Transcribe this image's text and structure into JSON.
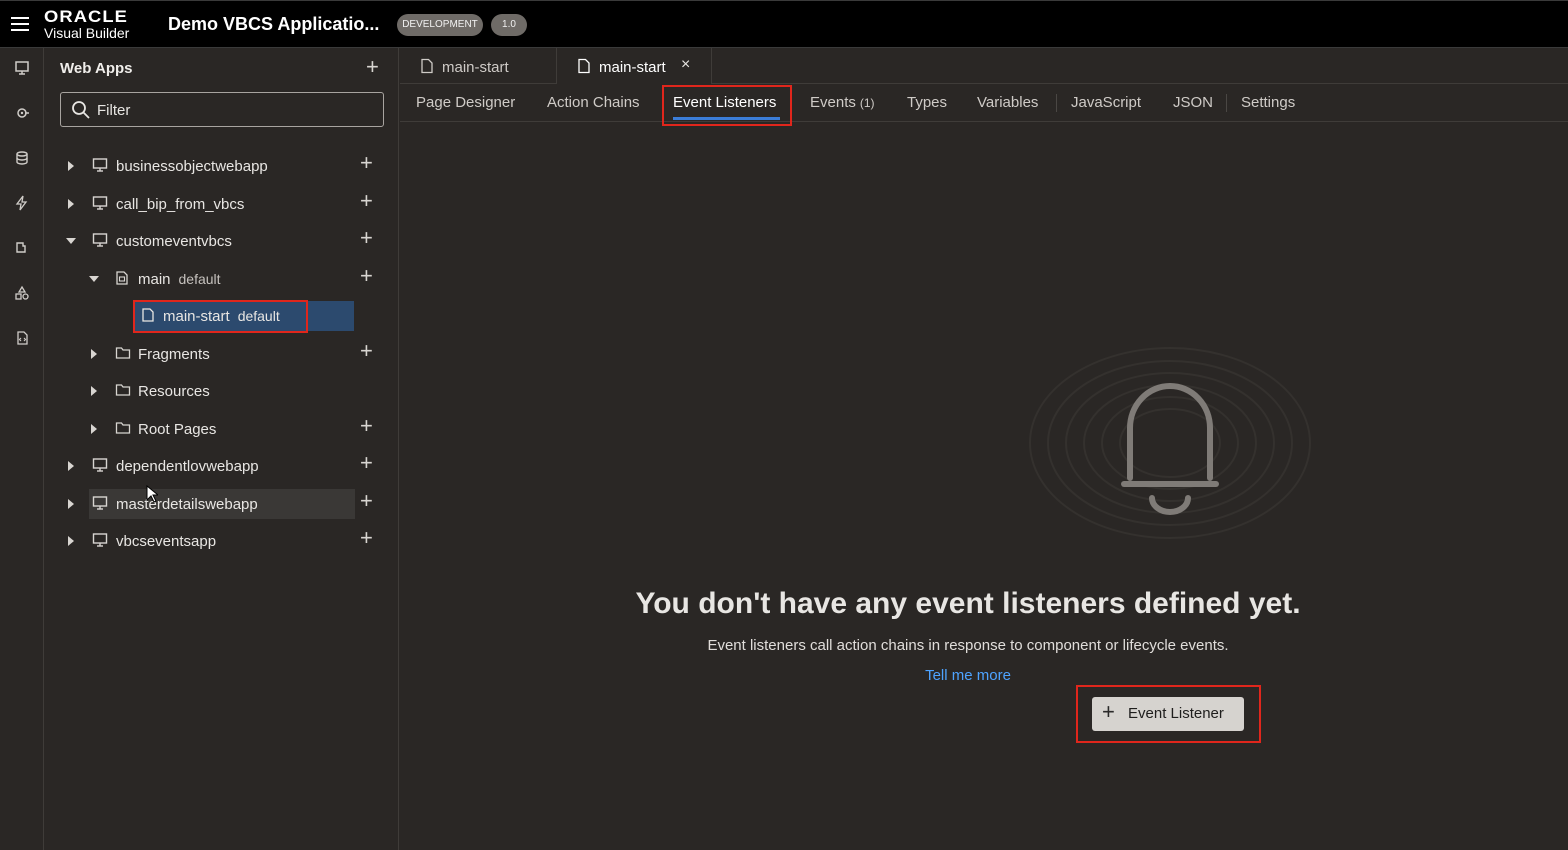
{
  "header": {
    "logo_top": "ORACLE",
    "logo_bottom": "Visual Builder",
    "app_title": "Demo VBCS Applicatio...",
    "env_badge": "DEVELOPMENT",
    "version_badge": "1.0"
  },
  "rail": {
    "icons": [
      "monitor-icon",
      "service-icon",
      "database-icon",
      "lightning-icon",
      "component-icon",
      "shapes-icon",
      "source-icon"
    ]
  },
  "navigator": {
    "title": "Web Apps",
    "filter_placeholder": "Filter",
    "tree": [
      {
        "label": "businessobjectwebapp",
        "sub": ""
      },
      {
        "label": "call_bip_from_vbcs",
        "sub": ""
      },
      {
        "label": "customeventvbcs",
        "sub": ""
      },
      {
        "label": "main",
        "sub": "default"
      },
      {
        "label": "main-start",
        "sub": "default"
      },
      {
        "label": "Fragments",
        "sub": ""
      },
      {
        "label": "Resources",
        "sub": ""
      },
      {
        "label": "Root Pages",
        "sub": ""
      },
      {
        "label": "dependentlovwebapp",
        "sub": ""
      },
      {
        "label": "masterdetailswebapp",
        "sub": ""
      },
      {
        "label": "vbcseventsapp",
        "sub": ""
      }
    ]
  },
  "file_tabs": [
    {
      "label": "main-start"
    },
    {
      "label": "main-start",
      "close": "×"
    }
  ],
  "sub_tabs": [
    {
      "label": "Page Designer"
    },
    {
      "label": "Action Chains"
    },
    {
      "label": "Event Listeners"
    },
    {
      "label": "Events",
      "count": "(1)"
    },
    {
      "label": "Types"
    },
    {
      "label": "Variables"
    },
    {
      "label": "JavaScript"
    },
    {
      "label": "JSON"
    },
    {
      "label": "Settings"
    }
  ],
  "empty_state": {
    "title": "You don't have any event listeners defined yet.",
    "description": "Event listeners call action chains in response to component or lifecycle events.",
    "link": "Tell me more",
    "button_label": "Event Listener",
    "button_icon": "+"
  },
  "colors": {
    "accent": "#3b7dd8",
    "highlight_box": "#e0261c",
    "selected_row": "#2c4a6e",
    "link": "#4ea3ff"
  }
}
